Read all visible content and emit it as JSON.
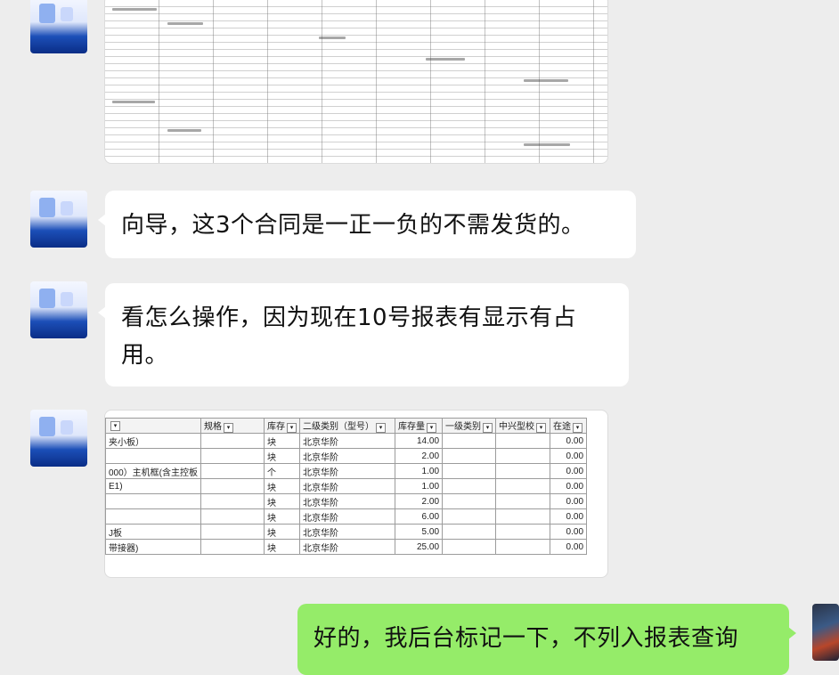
{
  "messages": [
    {
      "id": "m1",
      "type": "image",
      "sender": "other"
    },
    {
      "id": "m2",
      "type": "text",
      "sender": "other",
      "text": "向导，这3个合同是一正一负的不需发货的。"
    },
    {
      "id": "m3",
      "type": "text",
      "sender": "other",
      "lines": [
        "看怎么操作，因为现在10号报表有显示有占",
        "用。"
      ]
    },
    {
      "id": "m4",
      "type": "image",
      "sender": "other",
      "table": {
        "headers": [
          "",
          "规格",
          "库存",
          "二级类别（型号）",
          "库存量",
          "一级类别",
          "中兴型校",
          "在途"
        ],
        "rows": [
          [
            "夹小板）",
            "",
            "块",
            "北京华阶",
            "14.00",
            "",
            "",
            "0.00"
          ],
          [
            "",
            "",
            "块",
            "北京华阶",
            "2.00",
            "",
            "",
            "0.00"
          ],
          [
            "000）主机框(含主控板",
            "",
            "个",
            "北京华阶",
            "1.00",
            "",
            "",
            "0.00"
          ],
          [
            "E1)",
            "",
            "块",
            "北京华阶",
            "1.00",
            "",
            "",
            "0.00"
          ],
          [
            "",
            "",
            "块",
            "北京华阶",
            "2.00",
            "",
            "",
            "0.00"
          ],
          [
            "",
            "",
            "块",
            "北京华阶",
            "6.00",
            "",
            "",
            "0.00"
          ],
          [
            "J板",
            "",
            "块",
            "北京华阶",
            "5.00",
            "",
            "",
            "0.00"
          ],
          [
            "带接器)",
            "",
            "块",
            "北京华阶",
            "25.00",
            "",
            "",
            "0.00"
          ]
        ]
      }
    },
    {
      "id": "m5",
      "type": "text",
      "sender": "me",
      "text": "好的，我后台标记一下，不列入报表查询"
    }
  ],
  "colors": {
    "background": "#ededed",
    "bubble_other": "#ffffff",
    "bubble_me": "#95ec69"
  }
}
